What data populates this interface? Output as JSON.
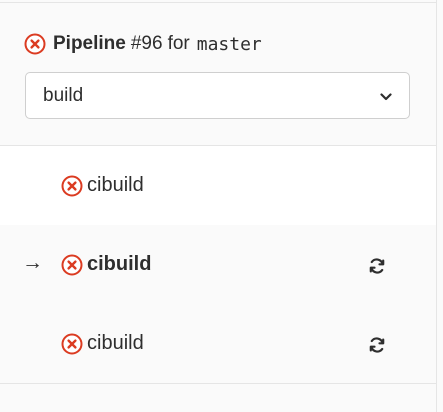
{
  "pipeline": {
    "status_icon": "status-failed-icon",
    "label": "Pipeline",
    "number": "#96",
    "for_text": "for",
    "ref": "master"
  },
  "stage_select": {
    "selected": "build",
    "icon": "chevron-down-icon"
  },
  "jobs": [
    {
      "name": "cibuild",
      "status_icon": "status-failed-icon",
      "retry_icon": "",
      "current": false
    },
    {
      "name": "cibuild",
      "status_icon": "status-failed-icon",
      "retry_icon": "retry-icon",
      "current": true,
      "marker": "→"
    },
    {
      "name": "cibuild",
      "status_icon": "status-failed-icon",
      "retry_icon": "retry-icon",
      "current": false
    }
  ],
  "colors": {
    "failed": "#db3b21",
    "text": "#2e2e2e",
    "border": "#e5e5e5",
    "background": "#fafafa"
  }
}
